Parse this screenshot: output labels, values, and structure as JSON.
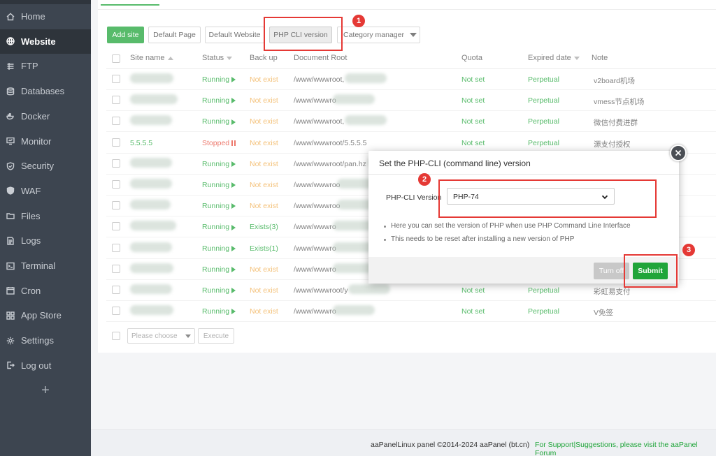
{
  "sidebar": {
    "items": [
      {
        "label": "Home",
        "icon": "home-icon"
      },
      {
        "label": "Website",
        "icon": "globe-icon"
      },
      {
        "label": "FTP",
        "icon": "ftp-icon"
      },
      {
        "label": "Databases",
        "icon": "database-icon"
      },
      {
        "label": "Docker",
        "icon": "docker-icon"
      },
      {
        "label": "Monitor",
        "icon": "monitor-icon"
      },
      {
        "label": "Security",
        "icon": "shield-icon"
      },
      {
        "label": "WAF",
        "icon": "waf-shield-icon"
      },
      {
        "label": "Files",
        "icon": "folder-icon"
      },
      {
        "label": "Logs",
        "icon": "logs-icon"
      },
      {
        "label": "Terminal",
        "icon": "terminal-icon"
      },
      {
        "label": "Cron",
        "icon": "cron-icon"
      },
      {
        "label": "App Store",
        "icon": "app-store-icon"
      },
      {
        "label": "Settings",
        "icon": "gear-icon"
      },
      {
        "label": "Log out",
        "icon": "logout-icon"
      }
    ],
    "active": "Website",
    "add_label": "+"
  },
  "toolbar": {
    "add_site": "Add site",
    "default_page": "Default Page",
    "default_website": "Default Website",
    "php_cli_version": "PHP CLI version",
    "category_manager": "Category manager"
  },
  "table": {
    "headers": {
      "site_name": "Site name",
      "status": "Status",
      "backup": "Back up",
      "root": "Document Root",
      "quota": "Quota",
      "expired": "Expired date",
      "note": "Note"
    },
    "rows": [
      {
        "name": "",
        "status": "Running",
        "backup": "Not exist",
        "root": "/www/wwwroot,",
        "quota": "Not set",
        "expired": "Perpetual",
        "note": "v2board机场"
      },
      {
        "name": "",
        "status": "Running",
        "backup": "Not exist",
        "root": "/www/wwwro",
        "quota": "Not set",
        "expired": "Perpetual",
        "note": "vmess节点机场"
      },
      {
        "name": "",
        "status": "Running",
        "backup": "Not exist",
        "root": "/www/wwwroot,",
        "quota": "Not set",
        "expired": "Perpetual",
        "note": "微信付费进群"
      },
      {
        "name": "5.5.5.5",
        "status": "Stopped",
        "backup": "Not exist",
        "root": "/www/wwwroot/5.5.5.5",
        "quota": "Not set",
        "expired": "Perpetual",
        "note": "源支付授权"
      },
      {
        "name": "",
        "status": "Running",
        "backup": "Not exist",
        "root": "/www/wwwroot/pan.hz",
        "quota": "",
        "expired": "",
        "note": ""
      },
      {
        "name": "",
        "status": "Running",
        "backup": "Not exist",
        "root": "/www/wwwroo",
        "quota": "",
        "expired": "",
        "note": ""
      },
      {
        "name": "",
        "status": "Running",
        "backup": "Not exist",
        "root": "/www/wwwroo",
        "quota": "",
        "expired": "",
        "note": ""
      },
      {
        "name": "",
        "status": "Running",
        "backup": "Exists(3)",
        "root": "/www/wwwro",
        "quota": "",
        "expired": "",
        "note": ""
      },
      {
        "name": "",
        "status": "Running",
        "backup": "Exists(1)",
        "root": "/www/wwwro",
        "quota": "",
        "expired": "",
        "note": ""
      },
      {
        "name": "",
        "status": "Running",
        "backup": "Not exist",
        "root": "/www/wwwro",
        "quota": "",
        "expired": "",
        "note": ""
      },
      {
        "name": "",
        "status": "Running",
        "backup": "Not exist",
        "root": "/www/wwwroot/y",
        "quota": "Not set",
        "expired": "Perpetual",
        "note": "彩虹易支付"
      },
      {
        "name": "",
        "status": "Running",
        "backup": "Not exist",
        "root": "/www/wwwro",
        "quota": "Not set",
        "expired": "Perpetual",
        "note": "V免签"
      }
    ]
  },
  "bulk": {
    "placeholder": "Please choose",
    "execute": "Execute"
  },
  "dialog": {
    "title": "Set the PHP-CLI (command line) version",
    "field_label": "PHP-CLI Version",
    "selected_version": "PHP-74",
    "tips": [
      "Here you can set the version of PHP when use PHP Command Line Interface",
      "This needs to be reset after installing a new version of PHP"
    ],
    "cancel": "Turn off",
    "submit": "Submit"
  },
  "footer": {
    "copyright": "aaPanelLinux panel ©2014-2024 aaPanel (bt.cn)",
    "support": "For Support|Suggestions, please visit the aaPanel Forum"
  },
  "annotations": {
    "badge1": "1",
    "badge2": "2",
    "badge3": "3"
  },
  "colors": {
    "accent": "#20a53a",
    "sidebar": "#3d4550",
    "annotation": "#e53935"
  }
}
